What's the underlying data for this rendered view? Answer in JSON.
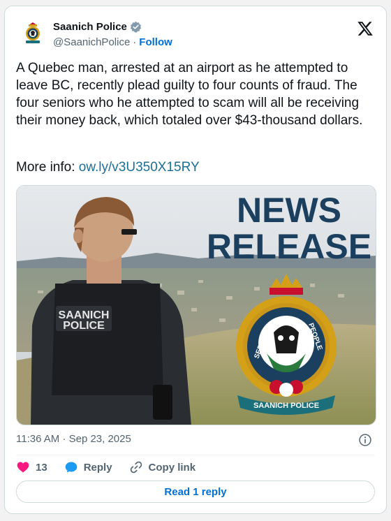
{
  "author": {
    "display_name": "Saanich Police",
    "handle": "@SaanichPolice",
    "separator": "·",
    "follow_label": "Follow"
  },
  "tweet": {
    "text": "A Quebec man, arrested at an airport as he attempted to leave BC, recently plead guilty to four counts of fraud. The four seniors who he attempted to scam will all be receiving their money back, which totaled over $43-thousand dollars.",
    "more_info_label": "More info: ",
    "link_text": "ow.ly/v3U350X15RY"
  },
  "media": {
    "vest_line1": "SAANICH",
    "vest_line2": "POLICE",
    "headline_line1": "NEWS",
    "headline_line2": "RELEASE",
    "crest_top": "THE",
    "crest_left": "SERVING",
    "crest_right": "PEOPLE",
    "crest_banner": "SAANICH POLICE"
  },
  "meta": {
    "timestamp": "11:36 AM · Sep 23, 2025"
  },
  "actions": {
    "like_count": "13",
    "reply_label": "Reply",
    "copy_link_label": "Copy link",
    "read_replies_label": "Read 1 reply"
  },
  "colors": {
    "link": "#1d6f95",
    "follow": "#006fd6",
    "like": "#f91880",
    "reply_icon": "#1d9bf0",
    "headline": "#1b3f5e"
  }
}
